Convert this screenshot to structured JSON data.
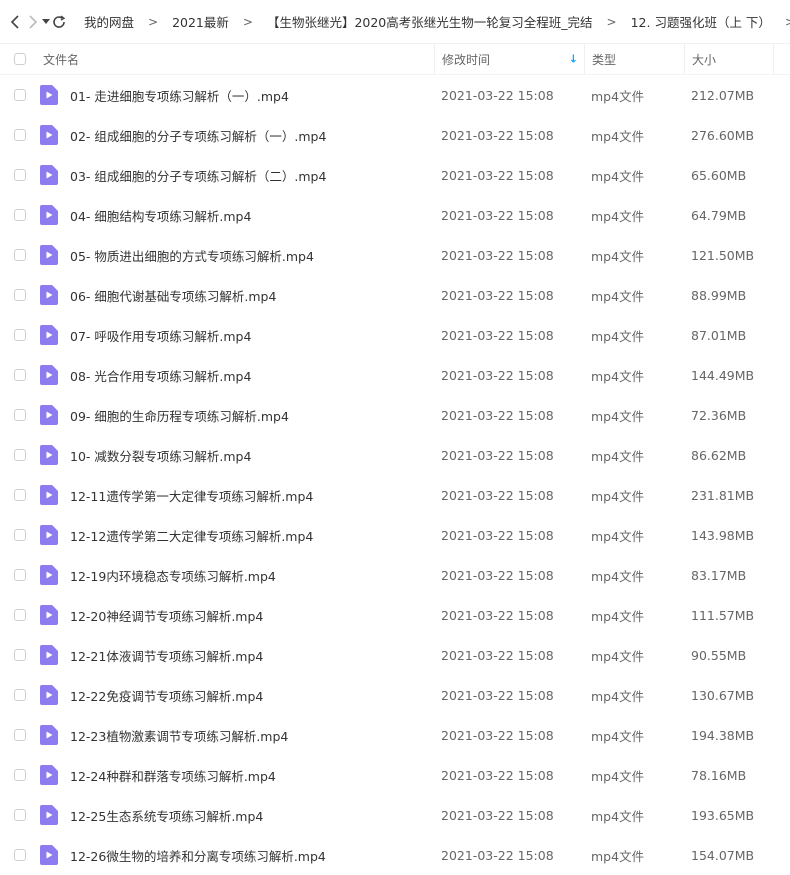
{
  "nav": {
    "back_icon": "chevron-left-icon",
    "forward_icon": "chevron-right-icon",
    "history_icon": "caret-down-icon",
    "refresh_icon": "refresh-icon"
  },
  "breadcrumbs": [
    "我的网盘",
    "2021最新",
    "【生物张继光】2020高考张继光生物一轮复习全程班_完结",
    "12. 习题强化班（上 下）"
  ],
  "breadcrumb_separator": ">",
  "columns": {
    "name": "文件名",
    "modified": "修改时间",
    "type": "类型",
    "size": "大小",
    "sort_indicator": "↓"
  },
  "colors": {
    "accent": "#06a7ff",
    "file_icon": "#8c7cf0"
  },
  "files": [
    {
      "name": "01- 走进细胞专项练习解析（一）.mp4",
      "modified": "2021-03-22 15:08",
      "type": "mp4文件",
      "size": "212.07MB"
    },
    {
      "name": "02- 组成细胞的分子专项练习解析（一）.mp4",
      "modified": "2021-03-22 15:08",
      "type": "mp4文件",
      "size": "276.60MB"
    },
    {
      "name": "03- 组成细胞的分子专项练习解析（二）.mp4",
      "modified": "2021-03-22 15:08",
      "type": "mp4文件",
      "size": "65.60MB"
    },
    {
      "name": "04- 细胞结构专项练习解析.mp4",
      "modified": "2021-03-22 15:08",
      "type": "mp4文件",
      "size": "64.79MB"
    },
    {
      "name": "05- 物质进出细胞的方式专项练习解析.mp4",
      "modified": "2021-03-22 15:08",
      "type": "mp4文件",
      "size": "121.50MB"
    },
    {
      "name": "06- 细胞代谢基础专项练习解析.mp4",
      "modified": "2021-03-22 15:08",
      "type": "mp4文件",
      "size": "88.99MB"
    },
    {
      "name": "07- 呼吸作用专项练习解析.mp4",
      "modified": "2021-03-22 15:08",
      "type": "mp4文件",
      "size": "87.01MB"
    },
    {
      "name": "08- 光合作用专项练习解析.mp4",
      "modified": "2021-03-22 15:08",
      "type": "mp4文件",
      "size": "144.49MB"
    },
    {
      "name": "09- 细胞的生命历程专项练习解析.mp4",
      "modified": "2021-03-22 15:08",
      "type": "mp4文件",
      "size": "72.36MB"
    },
    {
      "name": "10- 减数分裂专项练习解析.mp4",
      "modified": "2021-03-22 15:08",
      "type": "mp4文件",
      "size": "86.62MB"
    },
    {
      "name": "12-11遗传学第一大定律专项练习解析.mp4",
      "modified": "2021-03-22 15:08",
      "type": "mp4文件",
      "size": "231.81MB"
    },
    {
      "name": "12-12遗传学第二大定律专项练习解析.mp4",
      "modified": "2021-03-22 15:08",
      "type": "mp4文件",
      "size": "143.98MB"
    },
    {
      "name": "12-19内环境稳态专项练习解析.mp4",
      "modified": "2021-03-22 15:08",
      "type": "mp4文件",
      "size": "83.17MB"
    },
    {
      "name": "12-20神经调节专项练习解析.mp4",
      "modified": "2021-03-22 15:08",
      "type": "mp4文件",
      "size": "111.57MB"
    },
    {
      "name": "12-21体液调节专项练习解析.mp4",
      "modified": "2021-03-22 15:08",
      "type": "mp4文件",
      "size": "90.55MB"
    },
    {
      "name": "12-22免疫调节专项练习解析.mp4",
      "modified": "2021-03-22 15:08",
      "type": "mp4文件",
      "size": "130.67MB"
    },
    {
      "name": "12-23植物激素调节专项练习解析.mp4",
      "modified": "2021-03-22 15:08",
      "type": "mp4文件",
      "size": "194.38MB"
    },
    {
      "name": "12-24种群和群落专项练习解析.mp4",
      "modified": "2021-03-22 15:08",
      "type": "mp4文件",
      "size": "78.16MB"
    },
    {
      "name": "12-25生态系统专项练习解析.mp4",
      "modified": "2021-03-22 15:08",
      "type": "mp4文件",
      "size": "193.65MB"
    },
    {
      "name": "12-26微生物的培养和分离专项练习解析.mp4",
      "modified": "2021-03-22 15:08",
      "type": "mp4文件",
      "size": "154.07MB"
    }
  ]
}
